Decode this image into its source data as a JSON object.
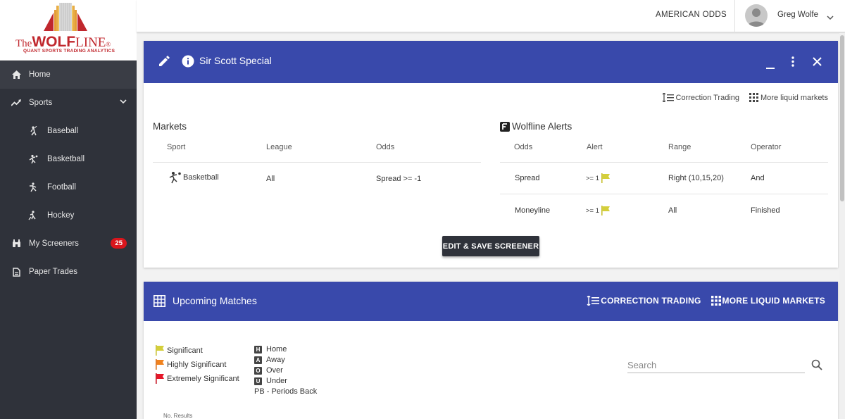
{
  "brand": {
    "logo_the": "The",
    "logo_wolf": "WOLF",
    "logo_line": "LINE",
    "logo_sub": "QUANT SPORTS TRADING ANALYTICS"
  },
  "sidebar": {
    "items": [
      {
        "label": "Home",
        "icon": "home-icon"
      },
      {
        "label": "Sports",
        "icon": "trending-icon"
      },
      {
        "label": "Baseball",
        "icon": "baseball-player-icon"
      },
      {
        "label": "Basketball",
        "icon": "basketball-player-icon"
      },
      {
        "label": "Football",
        "icon": "football-player-icon"
      },
      {
        "label": "Hockey",
        "icon": "hockey-player-icon"
      },
      {
        "label": "My Screeners",
        "icon": "binoculars-icon",
        "badge": "25"
      },
      {
        "label": "Paper Trades",
        "icon": "document-icon"
      }
    ]
  },
  "topbar": {
    "odds_label": "AMERICAN ODDS",
    "user_name": "Greg Wolfe"
  },
  "screener": {
    "title": "Sir Scott Special",
    "correction_trading": "Correction Trading",
    "more_liquid": "More liquid markets",
    "markets_title": "Markets",
    "markets_headers": [
      "Sport",
      "League",
      "Odds"
    ],
    "markets_rows": [
      {
        "sport": "Basketball",
        "league": "All",
        "odds": "Spread >= -1"
      }
    ],
    "alerts_title": "Wolfline Alerts",
    "alerts_headers": [
      "Odds",
      "Alert",
      "Range",
      "Operator"
    ],
    "alerts_rows": [
      {
        "odds": "Spread",
        "alert": ">= 1",
        "range": "Right (10,15,20)",
        "operator": "And"
      },
      {
        "odds": "Moneyline",
        "alert": ">= 1",
        "range": "All",
        "operator": "Finished"
      }
    ],
    "edit_button": "EDIT & SAVE SCREENER"
  },
  "matches": {
    "title": "Upcoming Matches",
    "correction_trading": "CORRECTION TRADING",
    "more_liquid": "MORE LIQUID MARKETS",
    "flags": [
      {
        "label": "Significant",
        "color": "#d4cf3a"
      },
      {
        "label": "Highly Significant",
        "color": "#f0821e"
      },
      {
        "label": "Extremely Significant",
        "color": "#e5172a"
      }
    ],
    "keys": [
      {
        "key": "H",
        "label": "Home"
      },
      {
        "key": "A",
        "label": "Away"
      },
      {
        "key": "O",
        "label": "Over"
      },
      {
        "key": "U",
        "label": "Under"
      }
    ],
    "pb_label": "PB - Periods Back",
    "search_placeholder": "Search",
    "no_results": "No. Results"
  },
  "colors": {
    "header_blue": "#3949ab",
    "sidebar_dark": "#2f323a",
    "badge_red": "#d9151c",
    "flag_yellow": "#d4cf3a"
  }
}
